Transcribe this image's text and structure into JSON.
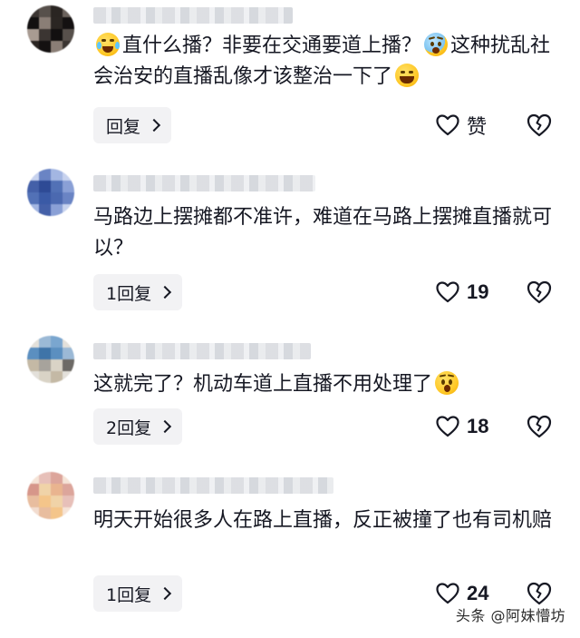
{
  "comments": [
    {
      "avatar_colors": [
        "#3b3532",
        "#57504b",
        "#2a2522",
        "#6b625c",
        "#121010",
        "#8a7e76",
        "#2b2623",
        "#141111",
        "#a89b92"
      ],
      "text_parts": [
        "",
        "直什么播？非要在交通要道上播？",
        "",
        "这种扰乱社会治安的直播乱像才该整治一下了",
        ""
      ],
      "emojis": [
        "laugh-cry-emoji",
        "crying-emoji",
        "grinning-emoji"
      ],
      "reply_label": "回复",
      "like_label": "赞"
    },
    {
      "avatar_colors": [
        "#6a84c4",
        "#4460a8",
        "#8aa0d6",
        "#5271b6",
        "#2e4a95",
        "#a3b6e2",
        "#4b69b0",
        "#3a5aa6",
        "#c7d2ee"
      ],
      "text": "马路边上摆摊都不准许，难道在马路上摆摊直播就可以？",
      "reply_label": "1回复",
      "like_count": "19"
    },
    {
      "avatar_colors": [
        "#5b8fc0",
        "#7aa6cf",
        "#d9d3c6",
        "#3f74a8",
        "#9bb9d6",
        "#c4b9a5",
        "#a7a39c",
        "#6d6a66",
        "#e3e0da"
      ],
      "text": "这就完了？机动车道上直播不用处理了",
      "emoji": "shocked-emoji",
      "reply_label": "2回复",
      "like_count": "18"
    },
    {
      "avatar_colors": [
        "#e7c0b9",
        "#f0d3a8",
        "#dca59b",
        "#e9b48f",
        "#f4c58a",
        "#d6968a",
        "#f2dccf",
        "#e8bd9f",
        "#f5e3d6"
      ],
      "text": "明天开始很多人在路上直播，反正被撞了也有司机赔",
      "reply_label": "1回复",
      "like_count": "24"
    }
  ],
  "watermark": "头条 @阿妹懵坊",
  "icons": {
    "like": "heart-outline-icon",
    "dislike": "broken-heart-icon",
    "reply_chevron": "chevron-right-icon"
  },
  "colors": {
    "text": "#161823",
    "button_bg": "#f2f2f4"
  }
}
